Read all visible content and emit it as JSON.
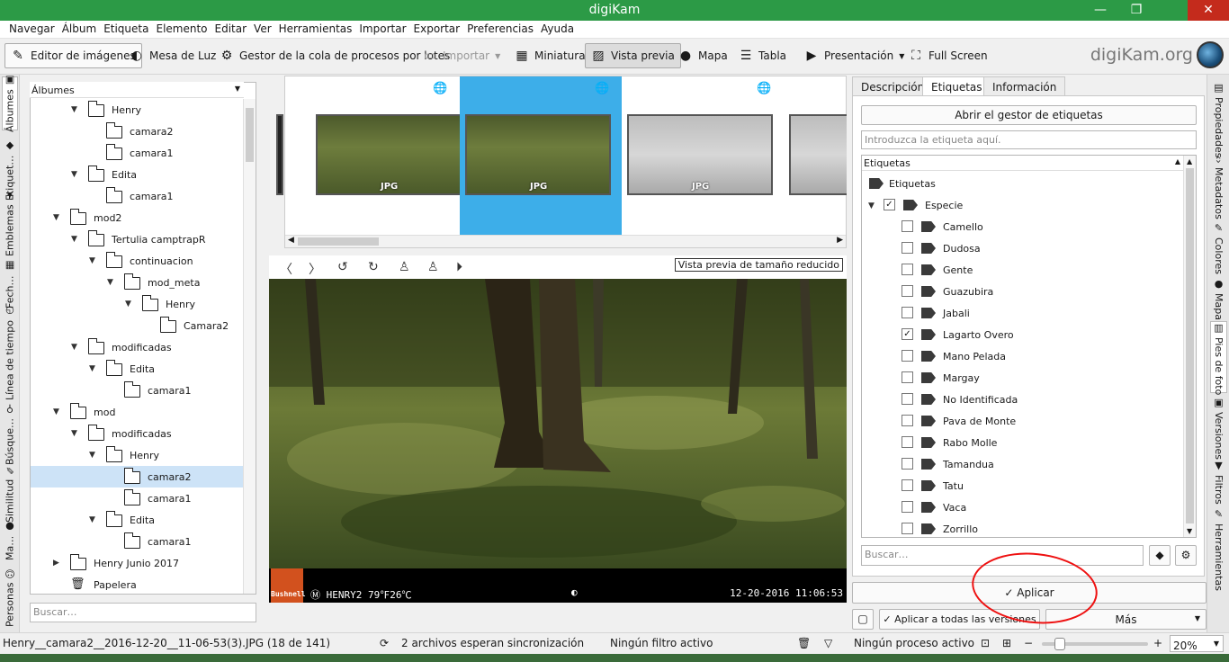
{
  "window": {
    "title": "digiKam",
    "min": "—",
    "max": "❐",
    "close": "✕"
  },
  "menu": [
    "Navegar",
    "Álbum",
    "Etiqueta",
    "Elemento",
    "Editar",
    "Ver",
    "Herramientas",
    "Importar",
    "Exportar",
    "Preferencias",
    "Ayuda"
  ],
  "toolbar": {
    "image_editor": "Editor de imágenes",
    "light_table": "Mesa de Luz",
    "queue_manager": "Gestor de la cola de procesos por lotes",
    "import": "Importar",
    "thumbnails": "Miniatura",
    "preview": "Vista previa",
    "map": "Mapa",
    "table": "Tabla",
    "slideshow": "Presentación",
    "fullscreen": "Full Screen",
    "brand": "digiKam.org"
  },
  "left_tabs": [
    "Álbumes",
    "Etiquet…",
    "Emblemas",
    "Fech…",
    "Línea de tiempo",
    "Búsque…",
    "Similitud",
    "Ma…",
    "Personas"
  ],
  "albums": {
    "header": "Álbumes",
    "search_placeholder": "Buscar…",
    "rows": [
      {
        "label": "Henry",
        "depth": 2,
        "arrow": "▼"
      },
      {
        "label": "camara2",
        "depth": 3,
        "arrow": ""
      },
      {
        "label": "camara1",
        "depth": 3,
        "arrow": ""
      },
      {
        "label": "Edita",
        "depth": 2,
        "arrow": "▼"
      },
      {
        "label": "camara1",
        "depth": 3,
        "arrow": ""
      },
      {
        "label": "mod2",
        "depth": 1,
        "arrow": "▼"
      },
      {
        "label": "Tertulia camptrapR",
        "depth": 2,
        "arrow": "▼"
      },
      {
        "label": "continuacion",
        "depth": 3,
        "arrow": "▼"
      },
      {
        "label": "mod_meta",
        "depth": 4,
        "arrow": "▼"
      },
      {
        "label": "Henry",
        "depth": 5,
        "arrow": "▼"
      },
      {
        "label": "Camara2",
        "depth": 6,
        "arrow": ""
      },
      {
        "label": "modificadas",
        "depth": 2,
        "arrow": "▼"
      },
      {
        "label": "Edita",
        "depth": 3,
        "arrow": "▼"
      },
      {
        "label": "camara1",
        "depth": 4,
        "arrow": ""
      },
      {
        "label": "mod",
        "depth": 1,
        "arrow": "▼"
      },
      {
        "label": "modificadas",
        "depth": 2,
        "arrow": "▼"
      },
      {
        "label": "Henry",
        "depth": 3,
        "arrow": "▼"
      },
      {
        "label": "camara2",
        "depth": 4,
        "arrow": "",
        "selected": true
      },
      {
        "label": "camara1",
        "depth": 4,
        "arrow": ""
      },
      {
        "label": "Edita",
        "depth": 3,
        "arrow": "▼"
      },
      {
        "label": "camara1",
        "depth": 4,
        "arrow": ""
      },
      {
        "label": "Henry Junio 2017",
        "depth": 1,
        "arrow": "▶"
      },
      {
        "label": "Papelera",
        "depth": 1,
        "arrow": "",
        "trash": true
      }
    ]
  },
  "filmstrip": {
    "badge": "JPG"
  },
  "preview": {
    "reduced_label": "Vista previa de tamaño reducido",
    "brand": "Bushnell",
    "stamp_left": "Ⓜ  HENRY2  79℉26℃",
    "stamp_moon": "◐",
    "stamp_right": "12-20-2016  11:06:53"
  },
  "right_panel": {
    "tabs": [
      "Descripción",
      "Etiquetas",
      "Información"
    ],
    "open_manager": "Abrir el gestor de etiquetas",
    "tag_input_placeholder": "Introduzca la etiqueta aquí.",
    "tree_header": "Etiquetas",
    "root": "Etiquetas",
    "group": "Especie",
    "tags": [
      {
        "label": "Camello",
        "checked": false
      },
      {
        "label": "Dudosa",
        "checked": false
      },
      {
        "label": "Gente",
        "checked": false
      },
      {
        "label": "Guazubira",
        "checked": false
      },
      {
        "label": "Jabali",
        "checked": false
      },
      {
        "label": "Lagarto Overo",
        "checked": true
      },
      {
        "label": "Mano Pelada",
        "checked": false
      },
      {
        "label": "Margay",
        "checked": false
      },
      {
        "label": "No Identificada",
        "checked": false
      },
      {
        "label": "Pava de Monte",
        "checked": false
      },
      {
        "label": "Rabo Molle",
        "checked": false
      },
      {
        "label": "Tamandua",
        "checked": false
      },
      {
        "label": "Tatu",
        "checked": false
      },
      {
        "label": "Vaca",
        "checked": false
      },
      {
        "label": "Zorrillo",
        "checked": false
      }
    ],
    "search_placeholder": "Buscar…",
    "apply": "Aplicar",
    "apply_all": "Aplicar a todas las versiones",
    "more": "Más"
  },
  "right_tabs": [
    "Propiedades",
    "Metadatos",
    "Colores",
    "Mapa",
    "Pies de foto",
    "Versiones",
    "Filtros",
    "Herramientas"
  ],
  "status": {
    "file": "Henry__camara2__2016-12-20__11-06-53(3).JPG (18 de 141)",
    "sync": "2 archivos esperan sincronización",
    "filter": "Ningún filtro activo",
    "process": "Ningún proceso activo",
    "zoom": "20%"
  },
  "colors": {
    "titlebar": "#2c9a46",
    "selection": "#3daee9",
    "annotation": "#e11111"
  }
}
